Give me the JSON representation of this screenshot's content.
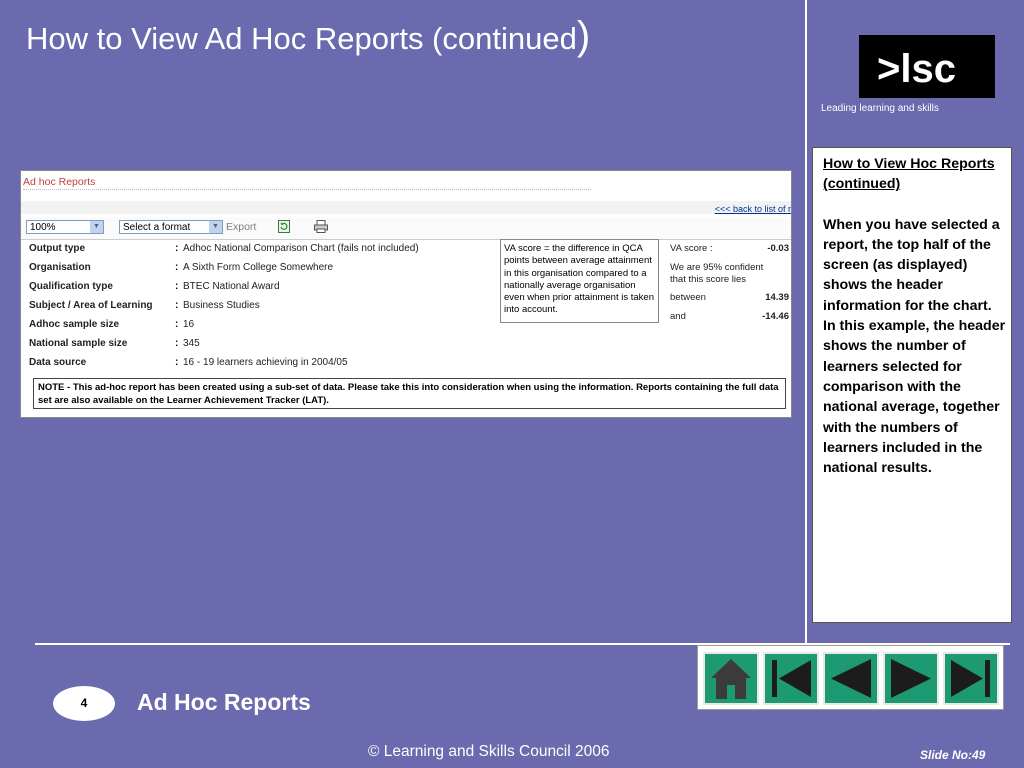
{
  "slide": {
    "title": "How to View Ad Hoc Reports (continued",
    "title_paren": ")",
    "logo_text": ">lsc",
    "tagline": "Leading learning and skills",
    "section": "Ad Hoc Reports",
    "page_badge": "4",
    "copyright": "© Learning and Skills Council 2006",
    "slide_no": "Slide No:49"
  },
  "notes": {
    "heading": "How to View Hoc Reports (continued)",
    "para1": "When you have selected a report, the top half of the screen (as displayed) shows the header information for the chart.",
    "para2": "In this example, the header shows the number of learners selected for comparison with the national average, together with the numbers of learners included in the national results."
  },
  "report": {
    "header": "Ad hoc Reports",
    "back_link": "<<< back to list of r",
    "zoom": "100%",
    "format_placeholder": "Select a format",
    "export_label": "Export",
    "fields": [
      {
        "label": "Output type",
        "value": "Adhoc National Comparison Chart (fails not included)"
      },
      {
        "label": "Organisation",
        "value": "A Sixth Form College Somewhere"
      },
      {
        "label": "Qualification type",
        "value": "BTEC National Award"
      },
      {
        "label": "Subject / Area of Learning",
        "value": "Business Studies"
      },
      {
        "label": "Adhoc sample size",
        "value": "16"
      },
      {
        "label": "National sample size",
        "value": "345"
      },
      {
        "label": "Data source",
        "value": "16 - 19 learners achieving in 2004/05"
      }
    ],
    "va_note": "VA score = the difference in QCA points between average attainment in this organisation compared to a nationally average organisation even when prior attainment is taken into account.",
    "va_label": "VA score :",
    "va_value": "-0.03",
    "confidence_text": "We are 95% confident that this score lies",
    "between_label": "between",
    "between_value": "14.39",
    "and_label": "and",
    "and_value": "-14.46",
    "note": "NOTE - This ad-hoc report has been created using a sub-set of data. Please take this into consideration when using the information. Reports containing the full data set are also available on the Learner Achievement Tracker (LAT)."
  },
  "nav": {
    "buttons": [
      "home-icon",
      "first-slide-icon",
      "previous-slide-icon",
      "next-slide-icon",
      "last-slide-icon"
    ]
  },
  "colors": {
    "background": "#6b6aae",
    "nav_green": "#1e9a73",
    "header_red": "#c04040"
  }
}
